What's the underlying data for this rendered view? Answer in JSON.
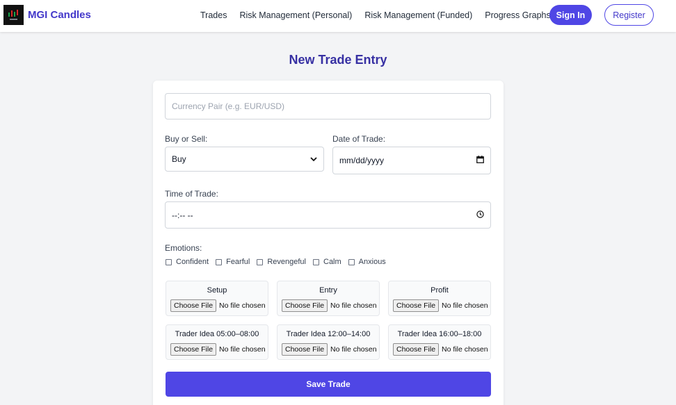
{
  "nav": {
    "brand": "MGI Candles",
    "links": [
      "Trades",
      "Risk Management (Personal)",
      "Risk Management (Funded)",
      "Progress Graphs"
    ],
    "sign_in": "Sign In",
    "register": "Register"
  },
  "page": {
    "title": "New Trade Entry"
  },
  "form": {
    "currency_pair_placeholder": "Currency Pair (e.g. EUR/USD)",
    "buy_sell_label": "Buy or Sell:",
    "buy_sell_value": "Buy",
    "date_label": "Date of Trade:",
    "date_value": "mm/dd/yyyy",
    "time_label": "Time of Trade:",
    "time_value": "--:-- --",
    "emotions_label": "Emotions:",
    "emotions": [
      "Confident",
      "Fearful",
      "Revengeful",
      "Calm",
      "Anxious"
    ],
    "uploads": [
      {
        "title": "Setup",
        "button": "Choose File",
        "status": "No file chosen"
      },
      {
        "title": "Entry",
        "button": "Choose File",
        "status": "No file chosen"
      },
      {
        "title": "Profit",
        "button": "Choose File",
        "status": "No file chosen"
      },
      {
        "title": "Trader Idea 05:00–08:00",
        "button": "Choose File",
        "status": "No file chosen"
      },
      {
        "title": "Trader Idea 12:00–14:00",
        "button": "Choose File",
        "status": "No file chosen"
      },
      {
        "title": "Trader Idea 16:00–18:00",
        "button": "Choose File",
        "status": "No file chosen"
      }
    ],
    "save_label": "Save Trade"
  },
  "colors": {
    "accent": "#4f46e5",
    "title": "#3730a3",
    "background": "#f3f4f6"
  }
}
